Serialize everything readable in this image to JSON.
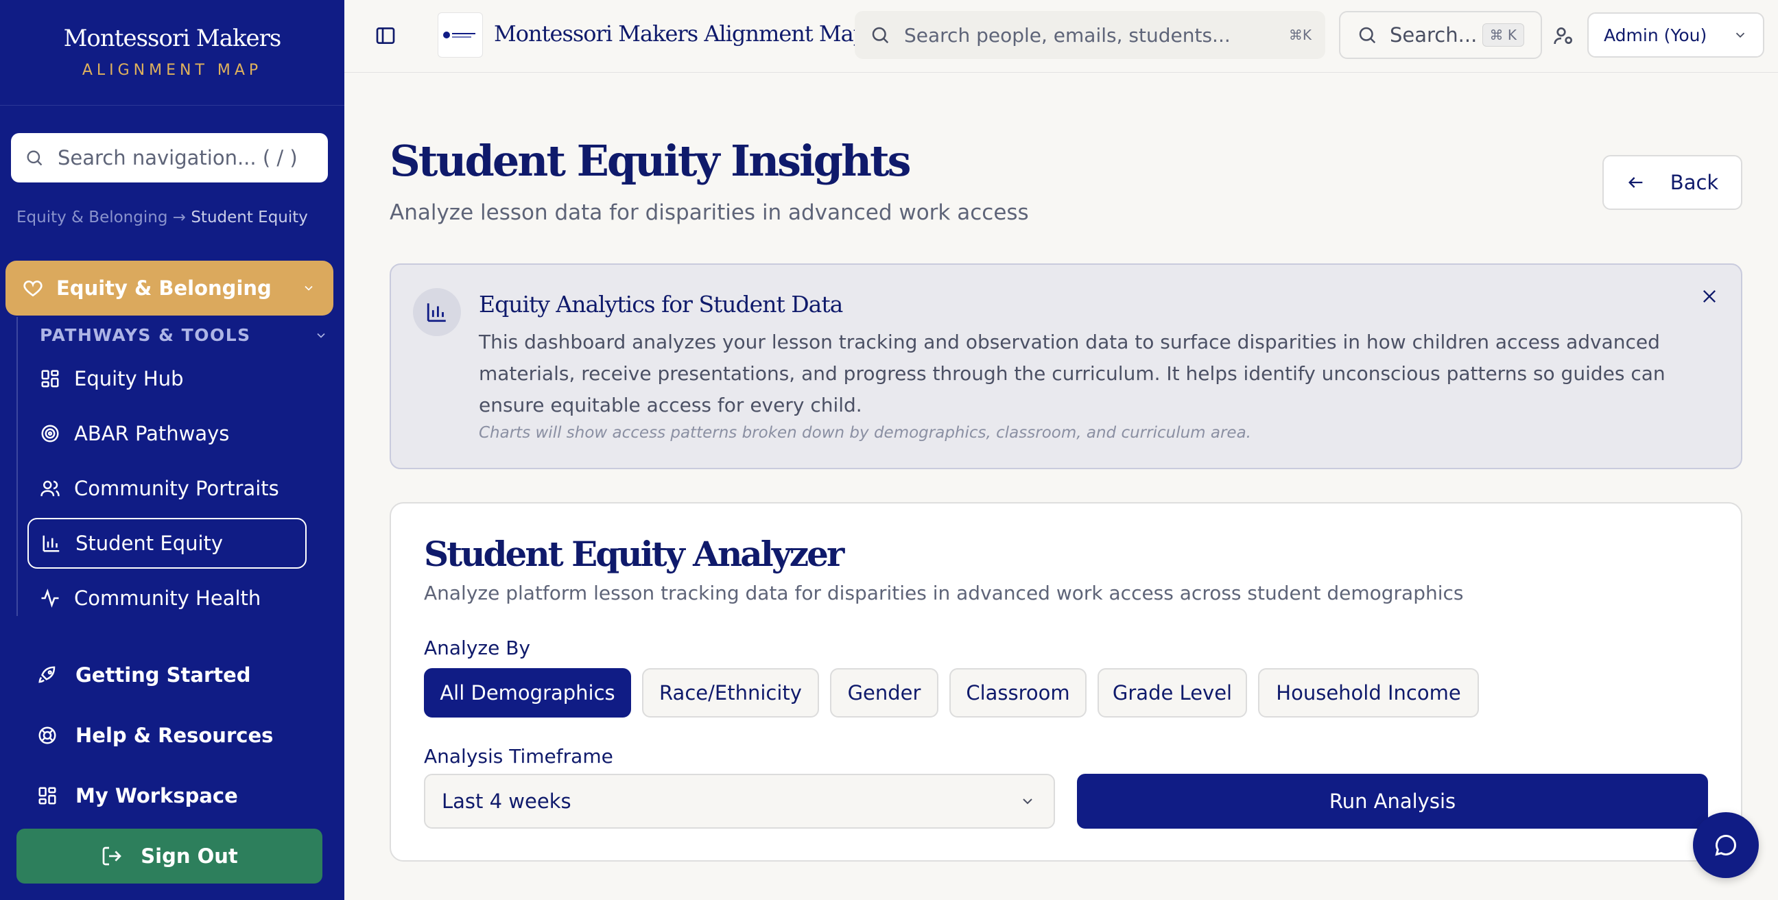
{
  "sidebar": {
    "brand_title": "Montessori Makers",
    "brand_subtitle": "ALIGNMENT MAP",
    "search_placeholder": "Search navigation... ( / )",
    "breadcrumb": {
      "parent": "Equity & Belonging",
      "separator": "→",
      "current": "Student Equity"
    },
    "group": {
      "label": "Equity & Belonging",
      "icon": "heart-icon"
    },
    "subgroup_label": "PATHWAYS & TOOLS",
    "items": [
      {
        "label": "Equity Hub",
        "icon": "grid-icon"
      },
      {
        "label": "ABAR Pathways",
        "icon": "target-icon"
      },
      {
        "label": "Community Portraits",
        "icon": "users-icon"
      },
      {
        "label": "Student Equity",
        "icon": "bar-chart-icon",
        "active": true
      },
      {
        "label": "Community Health",
        "icon": "activity-icon"
      }
    ],
    "main_items": [
      {
        "label": "Getting Started",
        "icon": "rocket-icon"
      },
      {
        "label": "Help & Resources",
        "icon": "lifebuoy-icon"
      },
      {
        "label": "My Workspace",
        "icon": "grid-icon"
      }
    ],
    "signout_label": "Sign Out"
  },
  "topbar": {
    "app_title": "Montessori Makers Alignment Map",
    "search_placeholder": "Search people, emails, students...",
    "search_shortcut": "⌘K",
    "search2_placeholder": "Search...",
    "search2_shortcut": "⌘ K",
    "user_label": "Admin (You)"
  },
  "page": {
    "title": "Student Equity Insights",
    "subtitle": "Analyze lesson data for disparities in advanced work access",
    "back_label": "Back"
  },
  "info": {
    "title": "Equity Analytics for Student Data",
    "body": "This dashboard analyzes your lesson tracking and observation data to surface disparities in how children access advanced materials, receive presentations, and progress through the curriculum. It helps identify unconscious patterns so guides can ensure equitable access for every child.",
    "note": "Charts will show access patterns broken down by demographics, classroom, and curriculum area."
  },
  "analyzer": {
    "title": "Student Equity Analyzer",
    "subtitle": "Analyze platform lesson tracking data for disparities in advanced work access across student demographics",
    "analyze_by_label": "Analyze By",
    "options": [
      "All Demographics",
      "Race/Ethnicity",
      "Gender",
      "Classroom",
      "Grade Level",
      "Household Income"
    ],
    "selected_option": "All Demographics",
    "timeframe_label": "Analysis Timeframe",
    "timeframe_value": "Last 4 weeks",
    "run_label": "Run Analysis"
  },
  "colors": {
    "primary": "#101c85",
    "accent": "#dba95d",
    "signout": "#2d7f5c"
  }
}
